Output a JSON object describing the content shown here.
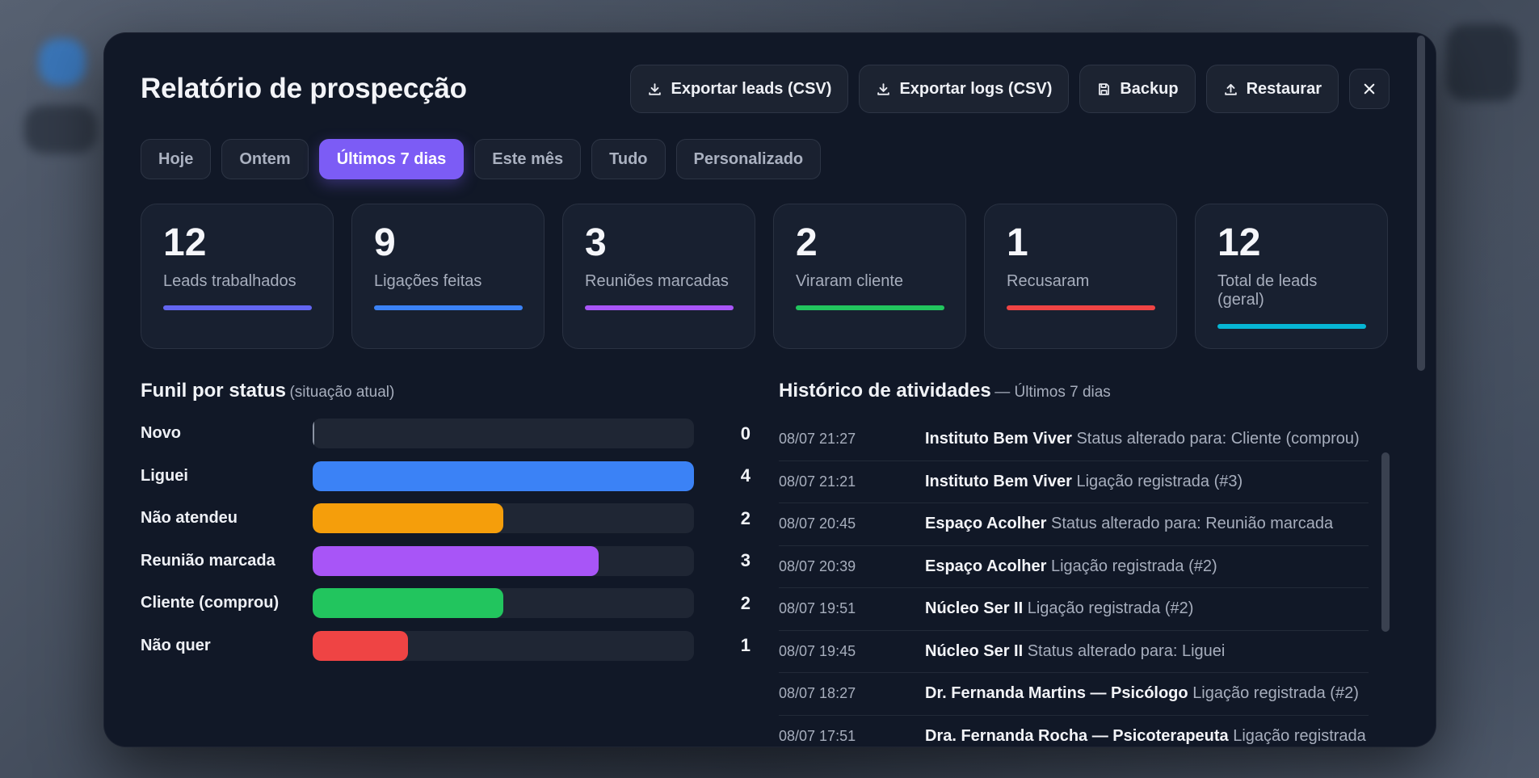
{
  "title": "Relatório de prospecção",
  "actions": {
    "export_leads": "Exportar leads (CSV)",
    "export_logs": "Exportar logs (CSV)",
    "backup": "Backup",
    "restore": "Restaurar"
  },
  "tabs": [
    {
      "label": "Hoje",
      "active": false
    },
    {
      "label": "Ontem",
      "active": false
    },
    {
      "label": "Últimos 7 dias",
      "active": true
    },
    {
      "label": "Este mês",
      "active": false
    },
    {
      "label": "Tudo",
      "active": false
    },
    {
      "label": "Personalizado",
      "active": false
    }
  ],
  "stats": [
    {
      "value": "12",
      "label": "Leads trabalhados",
      "color": "#6366f1"
    },
    {
      "value": "9",
      "label": "Ligações feitas",
      "color": "#3b82f6"
    },
    {
      "value": "3",
      "label": "Reuniões marcadas",
      "color": "#a855f7"
    },
    {
      "value": "2",
      "label": "Viraram cliente",
      "color": "#22c55e"
    },
    {
      "value": "1",
      "label": "Recusaram",
      "color": "#ef4444"
    },
    {
      "value": "12",
      "label": "Total de leads (geral)",
      "color": "#06b6d4"
    }
  ],
  "funnel": {
    "title": "Funil por status",
    "subtitle": "(situação atual)",
    "max": 4,
    "rows": [
      {
        "label": "Novo",
        "count": 0,
        "color": "#8b93a3"
      },
      {
        "label": "Liguei",
        "count": 4,
        "color": "#3b82f6"
      },
      {
        "label": "Não atendeu",
        "count": 2,
        "color": "#f59e0b"
      },
      {
        "label": "Reunião marcada",
        "count": 3,
        "color": "#a855f7"
      },
      {
        "label": "Cliente (comprou)",
        "count": 2,
        "color": "#22c55e"
      },
      {
        "label": "Não quer",
        "count": 1,
        "color": "#ef4444"
      }
    ]
  },
  "history": {
    "title": "Histórico de atividades",
    "subtitle": "— Últimos 7 dias",
    "items": [
      {
        "time": "08/07 21:27",
        "lead": "Instituto Bem Viver",
        "action": "Status alterado para: Cliente (comprou)"
      },
      {
        "time": "08/07 21:21",
        "lead": "Instituto Bem Viver",
        "action": "Ligação registrada (#3)"
      },
      {
        "time": "08/07 20:45",
        "lead": "Espaço Acolher",
        "action": "Status alterado para: Reunião marcada"
      },
      {
        "time": "08/07 20:39",
        "lead": "Espaço Acolher",
        "action": "Ligação registrada (#2)"
      },
      {
        "time": "08/07 19:51",
        "lead": "Núcleo Ser II",
        "action": "Ligação registrada (#2)"
      },
      {
        "time": "08/07 19:45",
        "lead": "Núcleo Ser II",
        "action": "Status alterado para: Liguei"
      },
      {
        "time": "08/07 18:27",
        "lead": "Dr. Fernanda Martins — Psicólogo",
        "action": "Ligação registrada (#2)"
      },
      {
        "time": "08/07 17:51",
        "lead": "Dra. Fernanda Rocha — Psicoterapeuta",
        "action": "Ligação registrada"
      }
    ]
  }
}
